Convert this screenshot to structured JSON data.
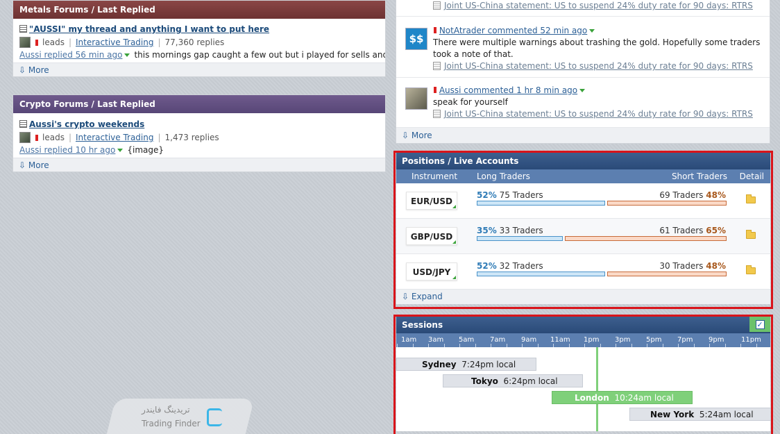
{
  "metals": {
    "header": "Metals Forums / Last Replied",
    "thread_title": "\"AUSSI\" my thread and anything I want to put here",
    "author": "leads",
    "category": "Interactive Trading",
    "replies": "77,360 replies",
    "last_reply": "Aussi replied 56 min ago",
    "snippet": "this mornings gap caught a few out but i played for sells and g",
    "more": "More"
  },
  "crypto": {
    "header": "Crypto Forums / Last Replied",
    "thread_title": "Aussi's crypto weekends",
    "author": "leads",
    "category": "Interactive Trading",
    "replies": "1,473 replies",
    "last_reply": "Aussi replied 10 hr ago",
    "snippet": "{image}",
    "more": "More"
  },
  "feed": {
    "items": [
      {
        "news": "Joint US-China statement: US to suspend 24% duty rate for 90 days: RTRS"
      },
      {
        "user": "NotAtrader commented 52 min ago",
        "comment": "There were multiple warnings about trashing the gold. Hopefully some traders took a note of that.",
        "news": "Joint US-China statement: US to suspend 24% duty rate for 90 days: RTRS"
      },
      {
        "user": "Aussi commented 1 hr 8 min ago",
        "comment": "speak for yourself",
        "news": "Joint US-China statement: US to suspend 24% duty rate for 90 days: RTRS"
      }
    ],
    "more": "More"
  },
  "positions": {
    "header": "Positions / Live Accounts",
    "col_instrument": "Instrument",
    "col_long": "Long Traders",
    "col_short": "Short Traders",
    "col_detail": "Detail",
    "rows": [
      {
        "instrument": "EUR/USD",
        "long_pct": "52%",
        "long_traders": "75 Traders",
        "short_traders": "69 Traders",
        "short_pct": "48%",
        "long_value": 52
      },
      {
        "instrument": "GBP/USD",
        "long_pct": "35%",
        "long_traders": "33 Traders",
        "short_traders": "61 Traders",
        "short_pct": "65%",
        "long_value": 35
      },
      {
        "instrument": "USD/JPY",
        "long_pct": "52%",
        "long_traders": "32 Traders",
        "short_traders": "30 Traders",
        "short_pct": "48%",
        "long_value": 52
      }
    ],
    "expand": "Expand"
  },
  "sessions": {
    "header": "Sessions",
    "checked": "✓",
    "times": [
      "1am",
      "3am",
      "5am",
      "7am",
      "9am",
      "11am",
      "1pm",
      "3pm",
      "5pm",
      "7pm",
      "9pm",
      "11pm"
    ],
    "items": [
      {
        "name": "Sydney",
        "local": "7:24pm local"
      },
      {
        "name": "Tokyo",
        "local": "6:24pm local"
      },
      {
        "name": "London",
        "local": "10:24am local"
      },
      {
        "name": "New York",
        "local": "5:24am local"
      }
    ]
  },
  "watermark": {
    "line1": "تریدینگ فایندر",
    "line2": "Trading Finder"
  }
}
